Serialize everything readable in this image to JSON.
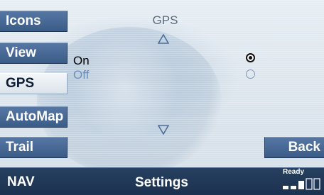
{
  "sidebar": {
    "items": [
      {
        "label": "Icons",
        "active": false
      },
      {
        "label": "View",
        "active": false
      },
      {
        "label": "GPS",
        "active": true
      },
      {
        "label": "AutoMap",
        "active": false
      },
      {
        "label": "Trail",
        "active": false
      }
    ]
  },
  "main": {
    "title": "GPS",
    "options": [
      {
        "label": "On",
        "selected": true
      },
      {
        "label": "Off",
        "selected": false
      }
    ]
  },
  "back_label": "Back",
  "bottom_bar": {
    "mode_label": "NAV",
    "screen_label": "Settings",
    "status_label": "Ready",
    "signal_icon": "signal-strength-icon"
  },
  "colors": {
    "button_blue": "#3c5c88",
    "active_button": "#eef2f6",
    "bottom_bar": "#1b3150",
    "on_text": "#000000",
    "off_text": "#6f8fb8"
  }
}
